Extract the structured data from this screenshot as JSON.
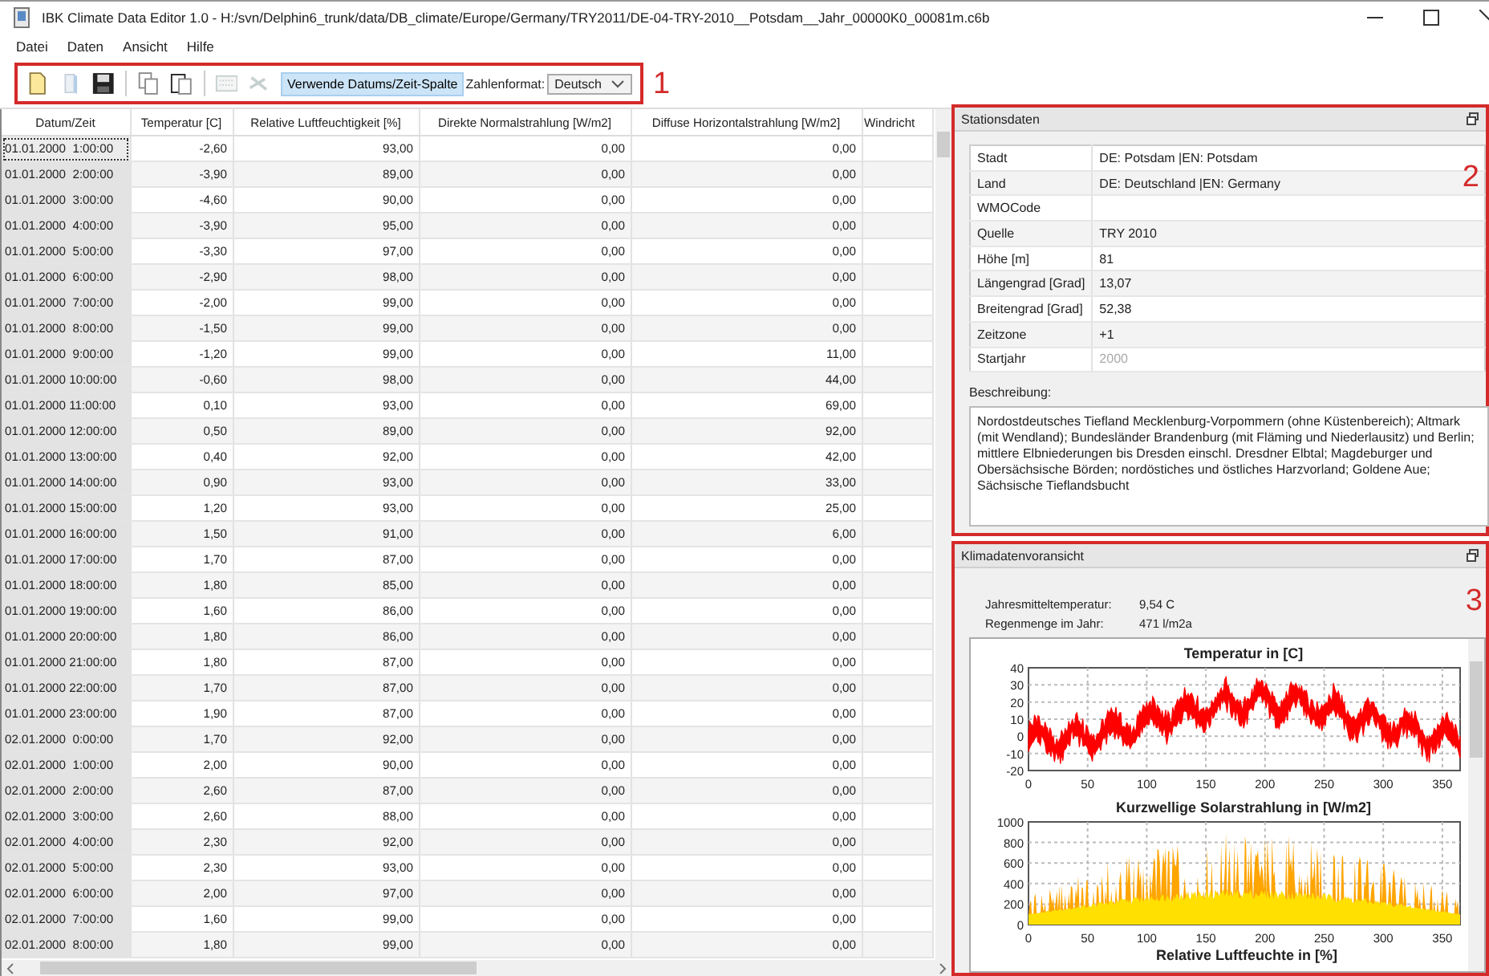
{
  "window": {
    "title": "IBK Climate Data Editor 1.0 - H:/svn/Delphin6_trunk/data/DB_climate/Europe/Germany/TRY2011/DE-04-TRY-2010__Potsdam__Jahr_00000K0_00081m.c6b"
  },
  "menu": [
    "Datei",
    "Daten",
    "Ansicht",
    "Hilfe"
  ],
  "toolbar": {
    "callout": "1",
    "tools": [
      {
        "kind": "new",
        "disabled": false
      },
      {
        "kind": "open",
        "disabled": true
      },
      {
        "kind": "save",
        "disabled": false
      },
      {
        "kind": "copy",
        "disabled": false
      },
      {
        "kind": "paste",
        "disabled": false
      },
      {
        "kind": "keyboard",
        "disabled": true
      },
      {
        "kind": "erase",
        "disabled": true
      }
    ],
    "toggle": {
      "label": "Verwende Datums/Zeit-Spalte",
      "checked": true
    },
    "number_format": {
      "label": "Zahlenformat:",
      "value": "Deutsch"
    }
  },
  "table": {
    "columns": [
      "Datum/Zeit",
      "Temperatur [C]",
      "Relative Luftfeuchtigkeit [%]",
      "Direkte Normalstrahlung [W/m2]",
      "Diffuse Horizontalstrahlung [W/m2]",
      "Windricht"
    ],
    "rows": [
      {
        "selected": true,
        "cells": [
          "01.01.2000  1:00:00",
          "-2,60",
          "93,00",
          "0,00",
          "0,00"
        ]
      },
      {
        "selected": false,
        "cells": [
          "01.01.2000  2:00:00",
          "-3,90",
          "89,00",
          "0,00",
          "0,00"
        ]
      },
      {
        "selected": false,
        "cells": [
          "01.01.2000  3:00:00",
          "-4,60",
          "90,00",
          "0,00",
          "0,00"
        ]
      },
      {
        "selected": false,
        "cells": [
          "01.01.2000  4:00:00",
          "-3,90",
          "95,00",
          "0,00",
          "0,00"
        ]
      },
      {
        "selected": false,
        "cells": [
          "01.01.2000  5:00:00",
          "-3,30",
          "97,00",
          "0,00",
          "0,00"
        ]
      },
      {
        "selected": false,
        "cells": [
          "01.01.2000  6:00:00",
          "-2,90",
          "98,00",
          "0,00",
          "0,00"
        ]
      },
      {
        "selected": false,
        "cells": [
          "01.01.2000  7:00:00",
          "-2,00",
          "99,00",
          "0,00",
          "0,00"
        ]
      },
      {
        "selected": false,
        "cells": [
          "01.01.2000  8:00:00",
          "-1,50",
          "99,00",
          "0,00",
          "0,00"
        ]
      },
      {
        "selected": false,
        "cells": [
          "01.01.2000  9:00:00",
          "-1,20",
          "99,00",
          "0,00",
          "11,00"
        ]
      },
      {
        "selected": false,
        "cells": [
          "01.01.2000 10:00:00",
          "-0,60",
          "98,00",
          "0,00",
          "44,00"
        ]
      },
      {
        "selected": false,
        "cells": [
          "01.01.2000 11:00:00",
          "0,10",
          "93,00",
          "0,00",
          "69,00"
        ]
      },
      {
        "selected": false,
        "cells": [
          "01.01.2000 12:00:00",
          "0,50",
          "89,00",
          "0,00",
          "92,00"
        ]
      },
      {
        "selected": false,
        "cells": [
          "01.01.2000 13:00:00",
          "0,40",
          "92,00",
          "0,00",
          "42,00"
        ]
      },
      {
        "selected": false,
        "cells": [
          "01.01.2000 14:00:00",
          "0,90",
          "93,00",
          "0,00",
          "33,00"
        ]
      },
      {
        "selected": false,
        "cells": [
          "01.01.2000 15:00:00",
          "1,20",
          "93,00",
          "0,00",
          "25,00"
        ]
      },
      {
        "selected": false,
        "cells": [
          "01.01.2000 16:00:00",
          "1,50",
          "91,00",
          "0,00",
          "6,00"
        ]
      },
      {
        "selected": false,
        "cells": [
          "01.01.2000 17:00:00",
          "1,70",
          "87,00",
          "0,00",
          "0,00"
        ]
      },
      {
        "selected": false,
        "cells": [
          "01.01.2000 18:00:00",
          "1,80",
          "85,00",
          "0,00",
          "0,00"
        ]
      },
      {
        "selected": false,
        "cells": [
          "01.01.2000 19:00:00",
          "1,60",
          "86,00",
          "0,00",
          "0,00"
        ]
      },
      {
        "selected": false,
        "cells": [
          "01.01.2000 20:00:00",
          "1,80",
          "86,00",
          "0,00",
          "0,00"
        ]
      },
      {
        "selected": false,
        "cells": [
          "01.01.2000 21:00:00",
          "1,80",
          "87,00",
          "0,00",
          "0,00"
        ]
      },
      {
        "selected": false,
        "cells": [
          "01.01.2000 22:00:00",
          "1,70",
          "87,00",
          "0,00",
          "0,00"
        ]
      },
      {
        "selected": false,
        "cells": [
          "01.01.2000 23:00:00",
          "1,90",
          "87,00",
          "0,00",
          "0,00"
        ]
      },
      {
        "selected": false,
        "cells": [
          "02.01.2000  0:00:00",
          "1,70",
          "92,00",
          "0,00",
          "0,00"
        ]
      },
      {
        "selected": false,
        "cells": [
          "02.01.2000  1:00:00",
          "2,00",
          "90,00",
          "0,00",
          "0,00"
        ]
      },
      {
        "selected": false,
        "cells": [
          "02.01.2000  2:00:00",
          "2,60",
          "87,00",
          "0,00",
          "0,00"
        ]
      },
      {
        "selected": false,
        "cells": [
          "02.01.2000  3:00:00",
          "2,60",
          "88,00",
          "0,00",
          "0,00"
        ]
      },
      {
        "selected": false,
        "cells": [
          "02.01.2000  4:00:00",
          "2,30",
          "92,00",
          "0,00",
          "0,00"
        ]
      },
      {
        "selected": false,
        "cells": [
          "02.01.2000  5:00:00",
          "2,30",
          "93,00",
          "0,00",
          "0,00"
        ]
      },
      {
        "selected": false,
        "cells": [
          "02.01.2000  6:00:00",
          "2,00",
          "97,00",
          "0,00",
          "0,00"
        ]
      },
      {
        "selected": false,
        "cells": [
          "02.01.2000  7:00:00",
          "1,60",
          "99,00",
          "0,00",
          "0,00"
        ]
      },
      {
        "selected": false,
        "cells": [
          "02.01.2000  8:00:00",
          "1,80",
          "99,00",
          "0,00",
          "0,00"
        ]
      }
    ]
  },
  "station": {
    "title": "Stationsdaten",
    "callout": "2",
    "fields": [
      {
        "label": "Stadt",
        "value": "DE: Potsdam |EN: Potsdam",
        "disabled": false
      },
      {
        "label": "Land",
        "value": "DE: Deutschland |EN: Germany",
        "disabled": false
      },
      {
        "label": "WMOCode",
        "disabled": false
      },
      {
        "label": "Quelle",
        "value": "TRY 2010",
        "disabled": false
      },
      {
        "label": "Höhe [m]",
        "value": "81",
        "disabled": false
      },
      {
        "label": "Längengrad [Grad]",
        "value": "13,07",
        "disabled": false
      },
      {
        "label": "Breitengrad [Grad]",
        "value": "52,38",
        "disabled": false
      },
      {
        "label": "Zeitzone",
        "value": "+1",
        "disabled": false
      },
      {
        "label": "Startjahr",
        "value": "2000",
        "disabled": true
      }
    ],
    "description_label": "Beschreibung:",
    "description": "Nordostdeutsches Tiefland Mecklenburg-Vorpommern (ohne Küstenbereich); Altmark (mit Wendland); Bundesländer Brandenburg (mit Fläming und Niederlausitz) und Berlin; mittlere Elbniederungen bis Dresden einschl. Dresdner Elbtal; Magdeburger und Obersächsische Börden; nordöstiches und östliches Harzvorland; Goldene Aue; Sächsische Tieflandsbucht"
  },
  "preview": {
    "title": "Klimadatenvoransicht",
    "callout": "3",
    "stats": [
      {
        "label": "Jahresmitteltemperatur:",
        "value": "9,54 C"
      },
      {
        "label": "Regenmenge im Jahr:",
        "value": "471 l/m2a"
      }
    ],
    "charts": [
      {
        "kind": "line",
        "title": "Temperatur in [C]",
        "color": "#ff0000",
        "yticks": [
          "40",
          "30",
          "20",
          "10",
          "0",
          "-10",
          "-20"
        ],
        "xticks": [
          "0",
          "50",
          "100",
          "150",
          "200",
          "250",
          "300",
          "350"
        ]
      },
      {
        "kind": "area",
        "title": "Kurzwellige Solarstrahlung in [W/m2]",
        "color": "#ffa500",
        "yticks": [
          "1000",
          "800",
          "600",
          "400",
          "200",
          "0"
        ],
        "xticks": [
          "0",
          "50",
          "100",
          "150",
          "200",
          "250",
          "300",
          "350"
        ]
      },
      {
        "kind": "title_only",
        "title": "Relative Luftfeuchte in [%]"
      }
    ]
  }
}
